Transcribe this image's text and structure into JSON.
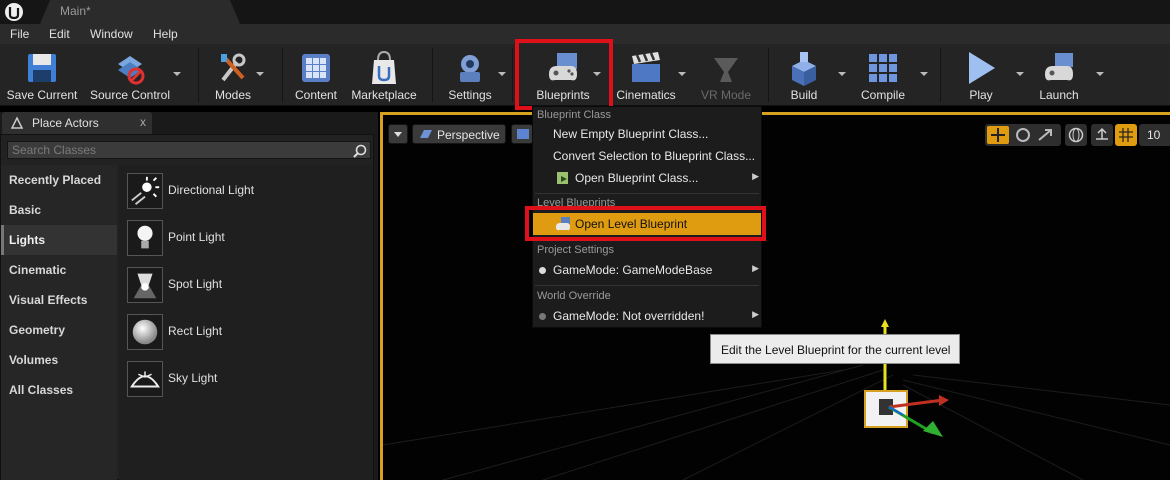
{
  "titlebar": {
    "tab_label": "Main*"
  },
  "menu": [
    "File",
    "Edit",
    "Window",
    "Help"
  ],
  "toolbar": {
    "save_current": "Save Current",
    "source_control": "Source Control",
    "modes": "Modes",
    "content": "Content",
    "marketplace": "Marketplace",
    "settings": "Settings",
    "blueprints": "Blueprints",
    "cinematics": "Cinematics",
    "vr_mode": "VR Mode",
    "build": "Build",
    "compile": "Compile",
    "play": "Play",
    "launch": "Launch"
  },
  "place_actors": {
    "tab_label": "Place Actors",
    "close": "x",
    "search_placeholder": "Search Classes",
    "categories": [
      "Recently Placed",
      "Basic",
      "Lights",
      "Cinematic",
      "Visual Effects",
      "Geometry",
      "Volumes",
      "All Classes"
    ],
    "selected_category": "Lights",
    "actors": [
      "Directional Light",
      "Point Light",
      "Spot Light",
      "Rect Light",
      "Sky Light"
    ]
  },
  "viewport": {
    "perspective": "Perspective",
    "grid_value": "10"
  },
  "blueprints_menu": {
    "section_blueprint_class": "Blueprint Class",
    "new_empty": "New Empty Blueprint Class...",
    "convert_selection": "Convert Selection to Blueprint Class...",
    "open_blueprint_class": "Open Blueprint Class...",
    "section_level_blueprints": "Level Blueprints",
    "open_level_blueprint": "Open Level Blueprint",
    "section_project_settings": "Project Settings",
    "gamemode_base": "GameMode: GameModeBase",
    "section_world_override": "World Override",
    "gamemode_not_overridden": "GameMode: Not overridden!"
  },
  "tooltip": {
    "text": "Edit the Level Blueprint for the current level"
  },
  "colors": {
    "highlight": "#e0101a",
    "active_item": "#e09c10",
    "viewport_border": "#d6a020"
  }
}
